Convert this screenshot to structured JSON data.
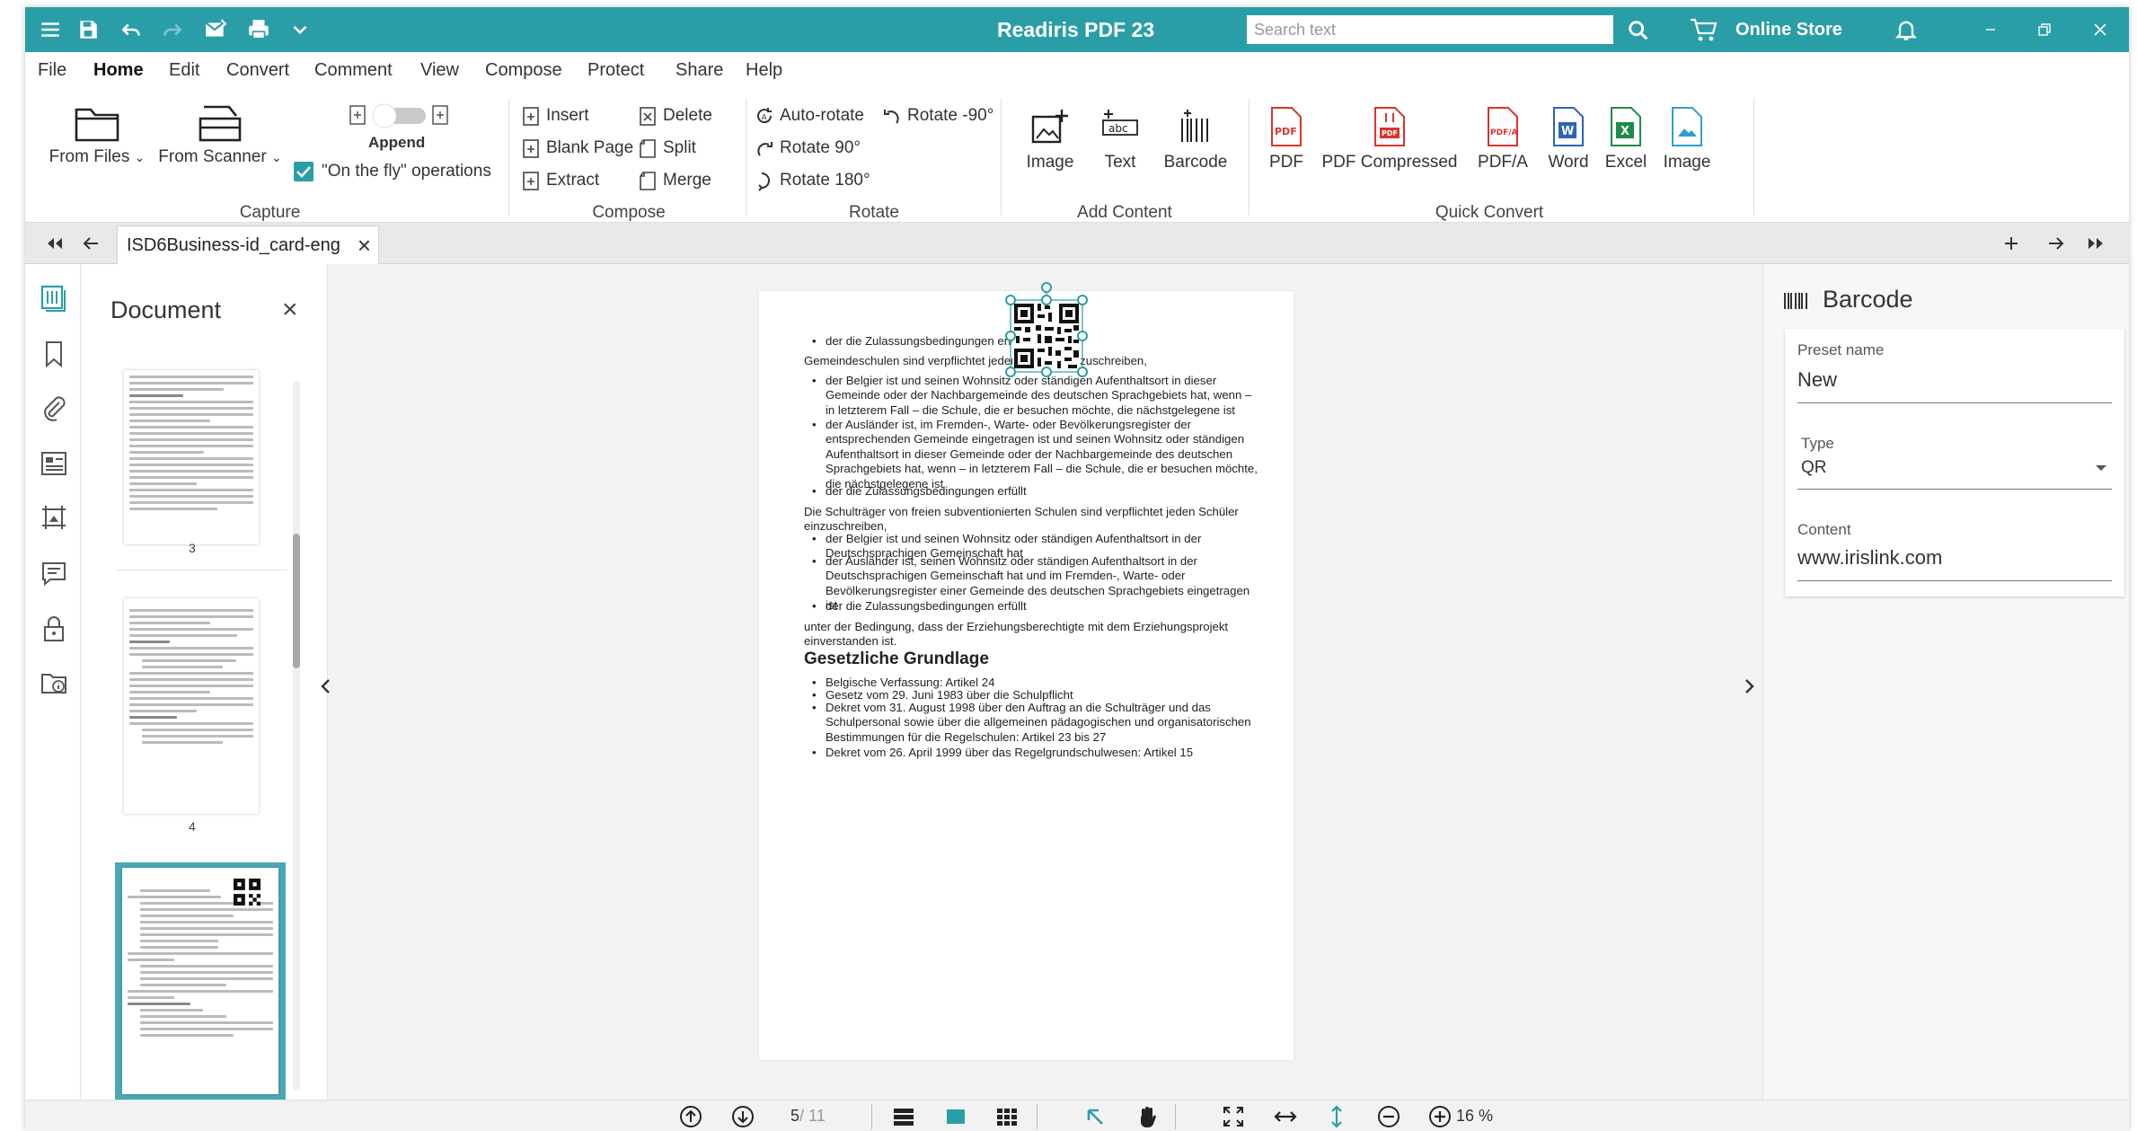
{
  "window": {
    "title": "Readiris PDF 23"
  },
  "titlebar": {
    "search_placeholder": "Search text",
    "store_label": "Online Store"
  },
  "menu": [
    "File",
    "Home",
    "Edit",
    "Convert",
    "Comment",
    "View",
    "Compose",
    "Protect",
    "Share",
    "Help"
  ],
  "ribbon": {
    "capture": {
      "label": "Capture",
      "from_files": "From Files",
      "from_scanner": "From Scanner",
      "append": "Append",
      "on_the_fly": "\"On the fly\" operations",
      "on_the_fly_checked": true
    },
    "compose": {
      "label": "Compose",
      "insert": "Insert",
      "delete": "Delete",
      "blank_page": "Blank Page",
      "split": "Split",
      "extract": "Extract",
      "merge": "Merge"
    },
    "rotate": {
      "label": "Rotate",
      "auto_rotate": "Auto-rotate",
      "rotate_m90": "Rotate -90°",
      "rotate_90": "Rotate 90°",
      "rotate_180": "Rotate 180°"
    },
    "add_content": {
      "label": "Add Content",
      "image": "Image",
      "text": "Text",
      "barcode": "Barcode"
    },
    "quick_convert": {
      "label": "Quick Convert",
      "pdf": "PDF",
      "pdf_compressed": "PDF Compressed",
      "pdfa": "PDF/A",
      "word": "Word",
      "excel": "Excel",
      "image": "Image"
    }
  },
  "tabs": {
    "document_tab": "ISD6Business-id_card-eng"
  },
  "document_panel": {
    "title": "Document",
    "thumbnails": [
      {
        "page": "3"
      },
      {
        "page": "4"
      }
    ]
  },
  "page_content": {
    "b0": "der die Zulassungsbedingungen erfüllt",
    "p1": "Gemeindeschulen sind verpflichtet jeden Schüler einzuschreiben,",
    "b1": "der Belgier ist und seinen Wohnsitz oder ständigen Aufenthaltsort in dieser Gemeinde oder der Nachbargemeinde des deutschen Sprachgebiets hat, wenn – in letzterem Fall – die Schule, die er besuchen möchte, die nächstgelegene ist",
    "b2": "der Ausländer ist, im Fremden-, Warte- oder Bevölkerungsregister der entsprechenden Gemeinde eingetragen ist und seinen Wohnsitz oder ständigen Aufenthaltsort in dieser Gemeinde oder der Nachbargemeinde des deutschen Sprachgebiets hat, wenn – in letzterem Fall – die Schule, die er besuchen möchte, die nächstgelegene ist",
    "b3": "der die Zulassungsbedingungen erfüllt",
    "p2": "Die Schulträger von freien subventionierten Schulen sind verpflichtet jeden Schüler einzuschreiben,",
    "b4": "der Belgier ist und seinen Wohnsitz oder ständigen Aufenthaltsort in der Deutschsprachigen Gemeinschaft hat",
    "b5": "der Ausländer ist, seinen Wohnsitz oder ständigen Aufenthaltsort in der Deutschsprachigen Gemeinschaft hat und im Fremden-, Warte- oder Bevölkerungsregister einer Gemeinde des deutschen Sprachgebiets eingetragen ist",
    "b6": "der die Zulassungsbedingungen erfüllt",
    "p3": "unter der Bedingung, dass der Erziehungsberechtigte mit dem Erziehungsprojekt einverstanden ist.",
    "h1": "Gesetzliche Grundlage",
    "b7": "Belgische Verfassung: Artikel 24",
    "b8": "Gesetz vom 29. Juni 1983 über die Schulpflicht",
    "b9": "Dekret vom 31. August 1998 über den Auftrag an die Schulträger und das Schulpersonal sowie über die allgemeinen pädagogischen und organisatorischen Bestimmungen für die Regelschulen: Artikel 23 bis 27",
    "b10": "Dekret vom 26. April 1999 über das Regelgrundschulwesen: Artikel 15"
  },
  "barcode_panel": {
    "title": "Barcode",
    "preset_label": "Preset name",
    "preset_value": "New",
    "type_label": "Type",
    "type_value": "QR",
    "content_label": "Content",
    "content_value": "www.irislink.com"
  },
  "bottombar": {
    "page_current": "5",
    "page_total": "/ 11",
    "zoom": "16 %"
  },
  "colors": {
    "accent": "#2a9ea6",
    "selected_thumb": "#4aa9b3"
  },
  "icons": [
    "menu-icon",
    "save-icon",
    "undo-icon",
    "redo-icon",
    "mail-icon",
    "print-icon",
    "chevron-down-icon",
    "search-icon",
    "cart-icon",
    "bell-icon",
    "minimize-icon",
    "restore-icon",
    "close-icon"
  ]
}
